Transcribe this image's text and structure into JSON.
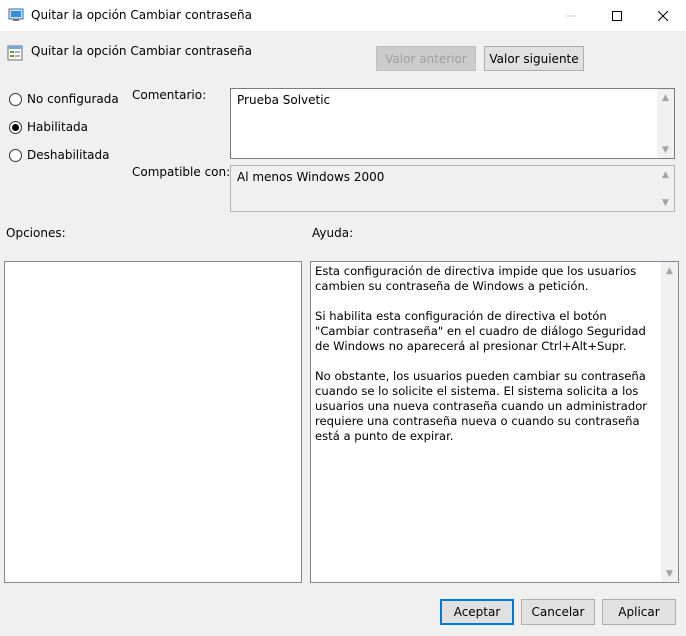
{
  "window": {
    "title": "Quitar la opción Cambiar contraseña"
  },
  "header": {
    "policy_name": "Quitar la opción Cambiar contraseña",
    "prev_button": "Valor anterior",
    "next_button": "Valor siguiente"
  },
  "state": {
    "options": [
      {
        "label": "No configurada",
        "selected": false
      },
      {
        "label": "Habilitada",
        "selected": true
      },
      {
        "label": "Deshabilitada",
        "selected": false
      }
    ]
  },
  "comment": {
    "label": "Comentario:",
    "value": "Prueba Solvetic"
  },
  "supported": {
    "label": "Compatible con:",
    "value": "Al menos Windows 2000"
  },
  "sections": {
    "options_label": "Opciones:",
    "help_label": "Ayuda:"
  },
  "help": {
    "paragraphs": [
      "Esta configuración de directiva impide que los usuarios cambien su contraseña de Windows a petición.",
      "Si habilita esta configuración de directiva el botón \"Cambiar contraseña\" en el cuadro de diálogo Seguridad de Windows no aparecerá al presionar Ctrl+Alt+Supr.",
      "No obstante, los usuarios pueden cambiar su contraseña cuando se lo solicite el sistema. El sistema solicita a los usuarios una nueva contraseña cuando un administrador requiere una contraseña nueva o cuando su contraseña está a punto de expirar."
    ]
  },
  "footer": {
    "ok": "Aceptar",
    "cancel": "Cancelar",
    "apply": "Aplicar"
  },
  "colors": {
    "accent": "#0078d7",
    "background": "#f0f0f0"
  }
}
